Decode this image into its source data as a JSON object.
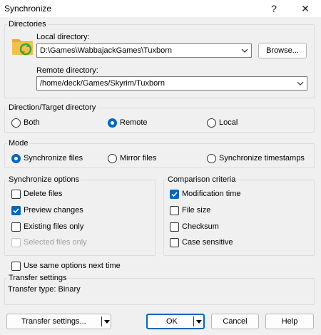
{
  "window": {
    "title": "Synchronize",
    "help_glyph": "?",
    "close_glyph": "✕"
  },
  "directories": {
    "group_label": "Directories",
    "local_label": "Local directory:",
    "local_value": "D:\\Games\\WabbajackGames\\Tuxborn",
    "browse_label": "Browse...",
    "remote_label": "Remote directory:",
    "remote_value": "/home/deck/Games/Skyrim/Tuxborn"
  },
  "direction": {
    "group_label": "Direction/Target directory",
    "options": [
      "Both",
      "Remote",
      "Local"
    ],
    "selected": "Remote"
  },
  "mode": {
    "group_label": "Mode",
    "options": [
      "Synchronize files",
      "Mirror files",
      "Synchronize timestamps"
    ],
    "selected": "Synchronize files"
  },
  "sync_options": {
    "group_label": "Synchronize options",
    "items": [
      {
        "label": "Delete files",
        "checked": false,
        "enabled": true
      },
      {
        "label": "Preview changes",
        "checked": true,
        "enabled": true
      },
      {
        "label": "Existing files only",
        "checked": false,
        "enabled": true
      },
      {
        "label": "Selected files only",
        "checked": false,
        "enabled": false
      }
    ]
  },
  "comparison": {
    "group_label": "Comparison criteria",
    "items": [
      {
        "label": "Modification time",
        "checked": true
      },
      {
        "label": "File size",
        "checked": false
      },
      {
        "label": "Checksum",
        "checked": false
      },
      {
        "label": "Case sensitive",
        "checked": false
      }
    ]
  },
  "same_options": {
    "label": "Use same options next time",
    "checked": false
  },
  "transfer": {
    "group_label": "Transfer settings",
    "type_text": "Transfer type: Binary"
  },
  "buttons": {
    "transfer_settings": "Transfer settings...",
    "ok": "OK",
    "cancel": "Cancel",
    "help": "Help"
  },
  "colors": {
    "accent": "#0067c0",
    "folder": "#f2c14e",
    "sync_arrows": "#3aa53a"
  }
}
